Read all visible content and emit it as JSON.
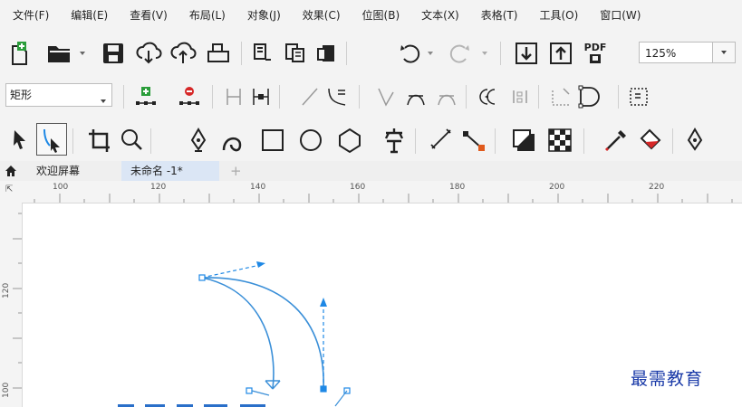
{
  "menu": [
    {
      "label": "文件(F)"
    },
    {
      "label": "编辑(E)"
    },
    {
      "label": "查看(V)"
    },
    {
      "label": "布局(L)"
    },
    {
      "label": "对象(J)"
    },
    {
      "label": "效果(C)"
    },
    {
      "label": "位图(B)"
    },
    {
      "label": "文本(X)"
    },
    {
      "label": "表格(T)"
    },
    {
      "label": "工具(O)"
    },
    {
      "label": "窗口(W)"
    }
  ],
  "toolbar": {
    "pdf_label": "PDF",
    "zoom_value": "125%"
  },
  "property_bar": {
    "shape_type": "矩形"
  },
  "tabs": [
    {
      "label": "欢迎屏幕"
    },
    {
      "label": "未命名 -1*"
    },
    {
      "label": "+"
    }
  ],
  "ruler": {
    "h_labels": [
      "100",
      "120",
      "140",
      "160",
      "180",
      "200",
      "220"
    ],
    "v_labels": [
      "120",
      "100"
    ],
    "corner": "⇱"
  },
  "canvas": {
    "watermark": "最需教育"
  },
  "colors": {
    "accent": "#1e88e5",
    "curve": "#3a8fd8",
    "toolbar_bg": "#f3f3f3",
    "tab_active": "#dbe6f5"
  }
}
